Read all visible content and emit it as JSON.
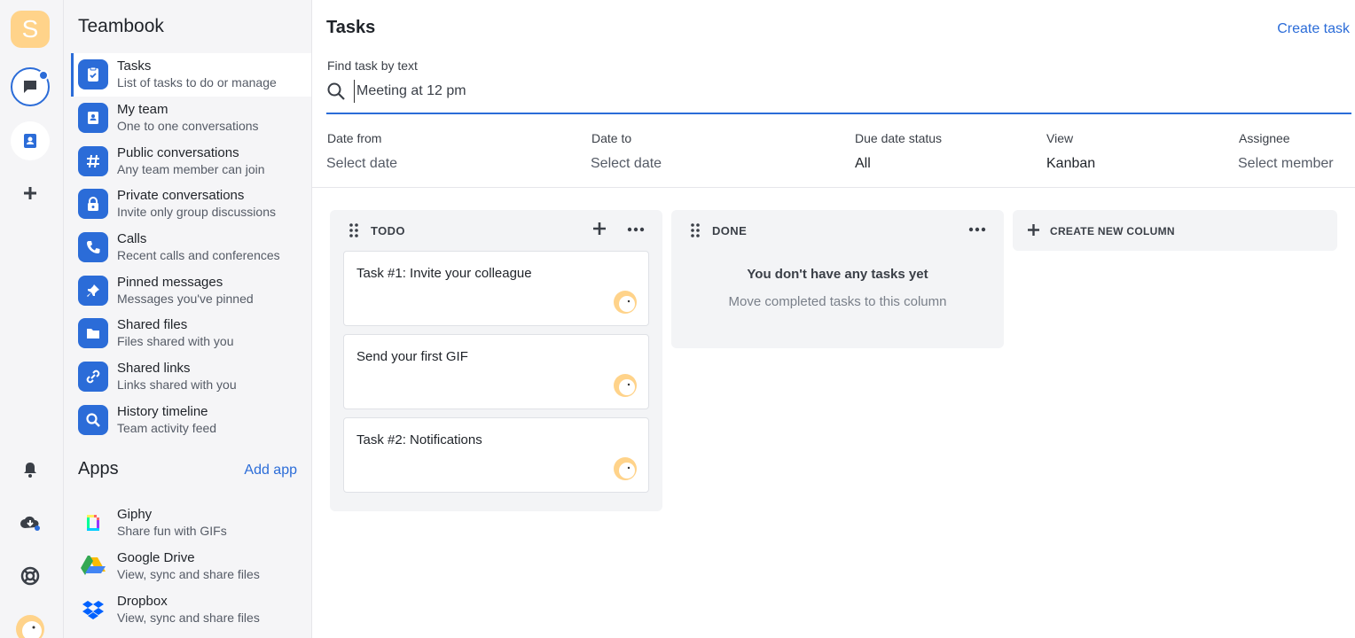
{
  "rail": {
    "workspace_initial": "S"
  },
  "sidebar": {
    "title": "Teambook",
    "items": [
      {
        "label": "Tasks",
        "sub": "List of tasks to do or manage",
        "icon": "clipboard-icon"
      },
      {
        "label": "My team",
        "sub": "One to one conversations",
        "icon": "contact-book-icon"
      },
      {
        "label": "Public conversations",
        "sub": "Any team member can join",
        "icon": "hashtag-icon"
      },
      {
        "label": "Private conversations",
        "sub": "Invite only group discussions",
        "icon": "lock-icon"
      },
      {
        "label": "Calls",
        "sub": "Recent calls and conferences",
        "icon": "phone-icon"
      },
      {
        "label": "Pinned messages",
        "sub": "Messages you've pinned",
        "icon": "pin-icon"
      },
      {
        "label": "Shared files",
        "sub": "Files shared with you",
        "icon": "folder-icon"
      },
      {
        "label": "Shared links",
        "sub": "Links shared with you",
        "icon": "link-icon"
      },
      {
        "label": "History timeline",
        "sub": "Team activity feed",
        "icon": "search-icon"
      }
    ],
    "apps_heading": "Apps",
    "add_app": "Add app",
    "apps": [
      {
        "label": "Giphy",
        "sub": "Share fun with GIFs"
      },
      {
        "label": "Google Drive",
        "sub": "View, sync and share files"
      },
      {
        "label": "Dropbox",
        "sub": "View, sync and share files"
      }
    ]
  },
  "main": {
    "title": "Tasks",
    "create_task": "Create task",
    "search_label": "Find task by text",
    "search_value": "Meeting at 12 pm",
    "filters": {
      "date_from_label": "Date from",
      "date_from_value": "Select date",
      "date_to_label": "Date to",
      "date_to_value": "Select date",
      "due_label": "Due date status",
      "due_value": "All",
      "view_label": "View",
      "view_value": "Kanban",
      "assignee_label": "Assignee",
      "assignee_value": "Select member"
    },
    "columns": {
      "todo": {
        "name": "TODO",
        "cards": [
          "Task #1: Invite your colleague",
          "Send your first GIF",
          "Task #2: Notifications"
        ]
      },
      "done": {
        "name": "DONE",
        "empty_title": "You don't have any tasks yet",
        "empty_sub": "Move completed tasks to this column"
      }
    },
    "create_column": "CREATE NEW COLUMN"
  },
  "colors": {
    "accent": "#2b6cd8",
    "avatar": "#ffd38a"
  }
}
